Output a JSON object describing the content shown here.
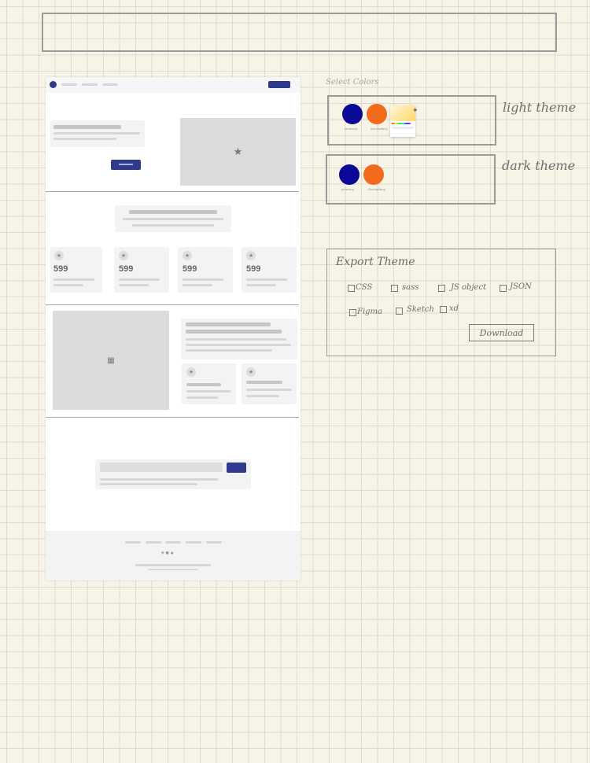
{
  "wireframe": {
    "stats": [
      {
        "value": "599"
      },
      {
        "value": "599"
      },
      {
        "value": "599"
      },
      {
        "value": "599"
      }
    ]
  },
  "color_panel": {
    "heading": "Select Colors",
    "light_label": "light theme",
    "dark_label": "dark theme",
    "primary_label": "primary",
    "secondary_label": "Secondary",
    "colors": {
      "primary": "#0a0a96",
      "secondary": "#f26b1d"
    }
  },
  "export": {
    "title": "Export Theme",
    "options": [
      "CSS",
      "sass",
      "JS object",
      "JSON",
      "Figma",
      "Sketch",
      "xd"
    ],
    "download_label": "Download"
  }
}
